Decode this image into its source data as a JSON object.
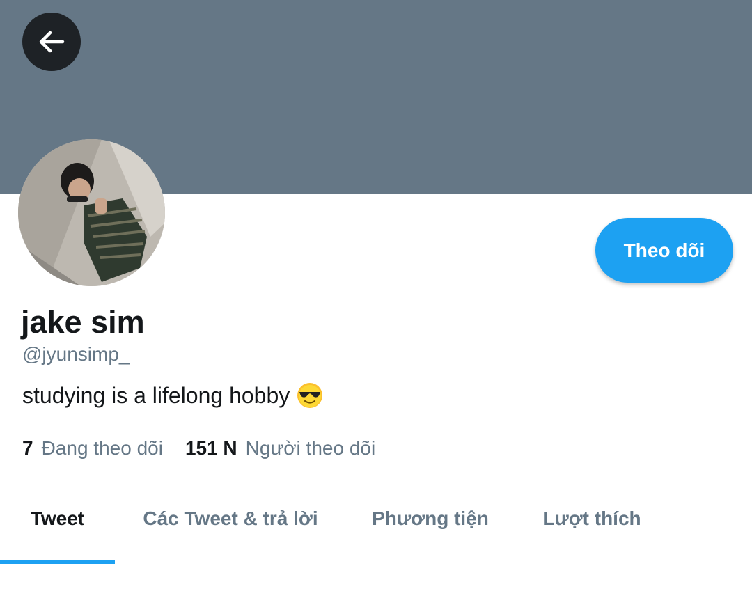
{
  "header": {
    "back_icon": "arrow-left-icon",
    "banner_color": "#657786"
  },
  "profile": {
    "avatar_icon": "profile-photo",
    "display_name": "jake sim",
    "handle": "@jyunsimp_",
    "bio": "studying is a lifelong hobby",
    "bio_emoji": "sunglasses-emoji",
    "follow_label": "Theo dõi",
    "accent_color": "#1da1f2"
  },
  "stats": {
    "following_count": "7",
    "following_label": "Đang theo dõi",
    "followers_count": "151 N",
    "followers_label": "Người theo dõi"
  },
  "tabs": [
    {
      "label": "Tweet",
      "active": true
    },
    {
      "label": "Các Tweet & trả lời",
      "active": false
    },
    {
      "label": "Phương tiện",
      "active": false
    },
    {
      "label": "Lượt thích",
      "active": false
    }
  ]
}
